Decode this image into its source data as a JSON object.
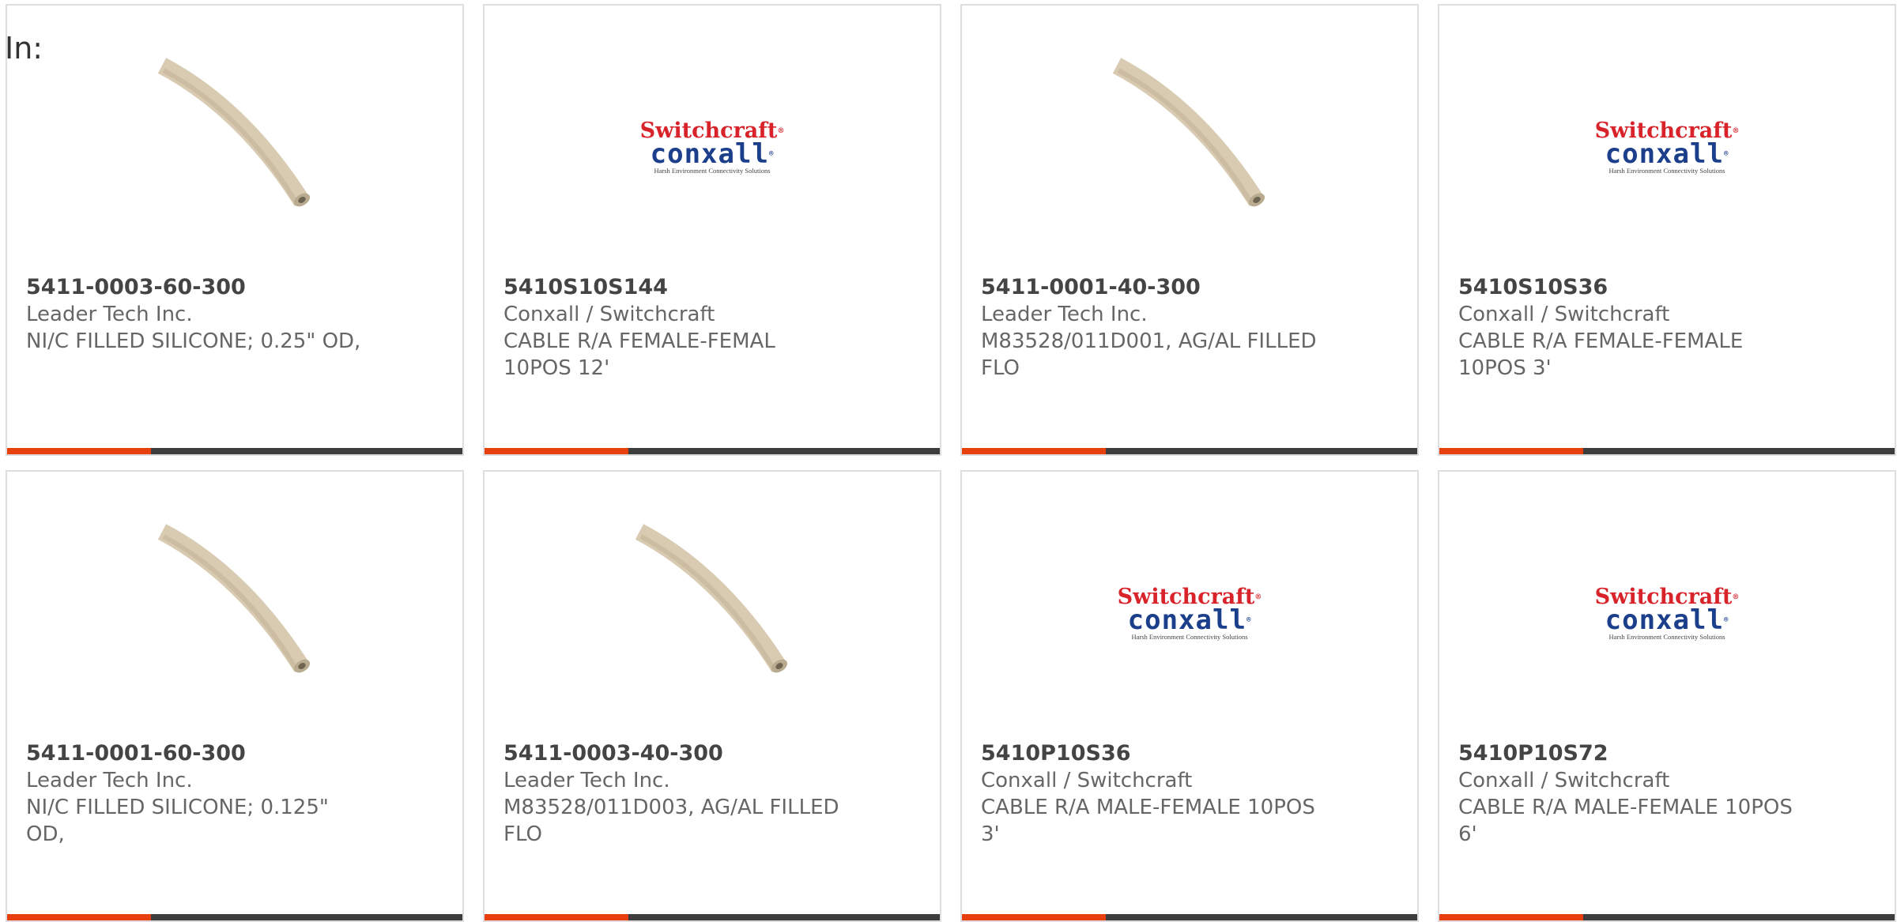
{
  "filter_label": "In:",
  "colors": {
    "accent_bar": "#e8400c",
    "dark_bar": "#3d3d3d",
    "logo_red": "#d8232a",
    "logo_blue": "#1b3f8b",
    "tube": "#d8cbb2"
  },
  "logo": {
    "brand_top": "Switchcraft",
    "brand_bottom": "conxall",
    "tagline": "Harsh Environment Connectivity Solutions",
    "mark": "®"
  },
  "products": [
    {
      "part_number": "5411-0003-60-300",
      "manufacturer": "Leader Tech Inc.",
      "description": "NI/C FILLED SILICONE; 0.25\" OD,",
      "image": "tube-icon"
    },
    {
      "part_number": "5410S10S144",
      "manufacturer": "Conxall / Switchcraft",
      "description": "CABLE R/A FEMALE-FEMAL 10POS 12'",
      "image": "switchcraft-logo"
    },
    {
      "part_number": "5411-0001-40-300",
      "manufacturer": "Leader Tech Inc.",
      "description": "M83528/011D001, AG/AL FILLED FLO",
      "image": "tube-icon"
    },
    {
      "part_number": "5410S10S36",
      "manufacturer": "Conxall / Switchcraft",
      "description": "CABLE R/A FEMALE-FEMALE 10POS 3'",
      "image": "switchcraft-logo"
    },
    {
      "part_number": "5411-0001-60-300",
      "manufacturer": "Leader Tech Inc.",
      "description": "NI/C FILLED SILICONE; 0.125\" OD,",
      "image": "tube-icon"
    },
    {
      "part_number": "5411-0003-40-300",
      "manufacturer": "Leader Tech Inc.",
      "description": "M83528/011D003, AG/AL FILLED FLO",
      "image": "tube-icon"
    },
    {
      "part_number": "5410P10S36",
      "manufacturer": "Conxall / Switchcraft",
      "description": "CABLE R/A MALE-FEMALE 10POS 3'",
      "image": "switchcraft-logo"
    },
    {
      "part_number": "5410P10S72",
      "manufacturer": "Conxall / Switchcraft",
      "description": "CABLE R/A MALE-FEMALE 10POS 6'",
      "image": "switchcraft-logo"
    }
  ]
}
